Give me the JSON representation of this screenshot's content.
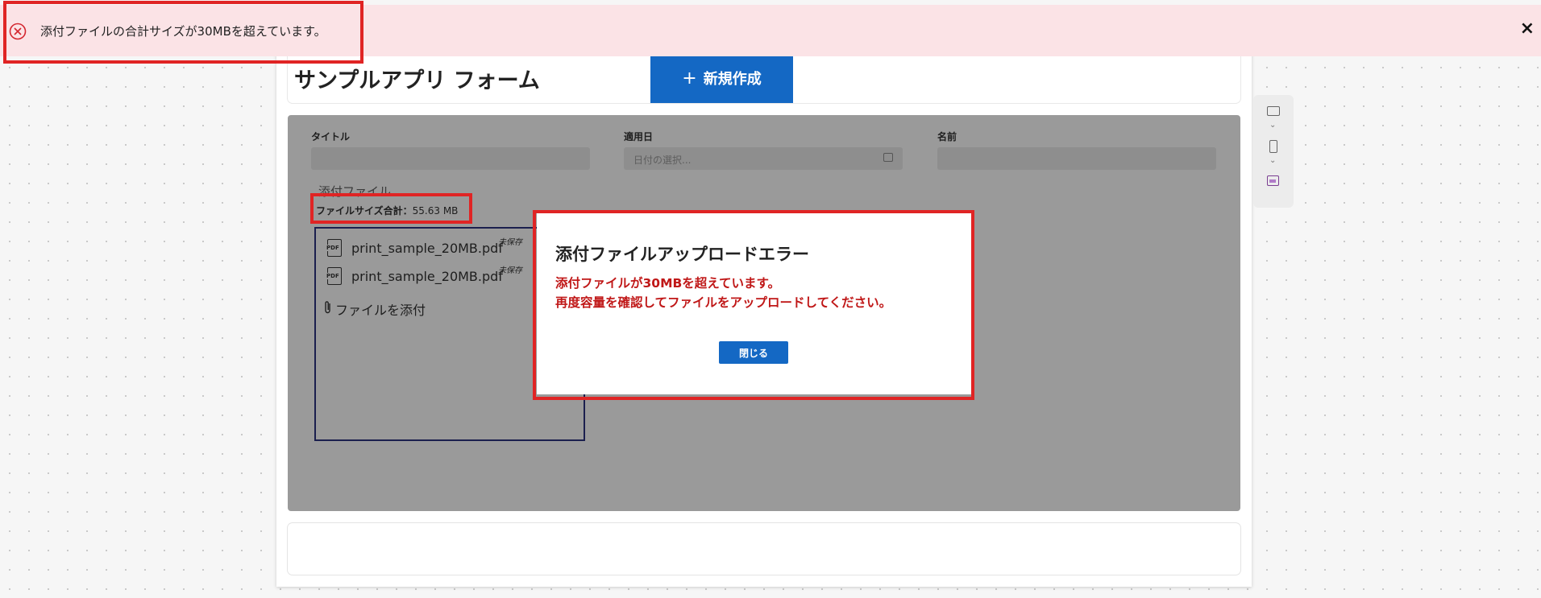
{
  "notification": {
    "message": "添付ファイルの合計サイズが30MBを超えています。",
    "close_symbol": "×",
    "icon": "error-circle-icon"
  },
  "header": {
    "app_title": "サンプルアプリ フォーム",
    "new_button_label": "新規作成",
    "new_button_plus": "+"
  },
  "form": {
    "title_label": "タイトル",
    "date_label": "適用日",
    "date_placeholder": "日付の選択...",
    "name_label": "名前",
    "attachment_label": "添付ファイル",
    "size_total_label": "ファイルサイズ合計：",
    "size_total_value": "55.63 MB",
    "files": [
      {
        "name": "print_sample_20MB.pdf",
        "status": "未保存",
        "icon_text": "PDF"
      },
      {
        "name": "print_sample_20MB.pdf",
        "status": "未保存",
        "icon_text": "PDF"
      }
    ],
    "attach_button_label": "ファイルを添付"
  },
  "dialog": {
    "title": "添付ファイルアップロードエラー",
    "message_line1": "添付ファイルが30MBを超えています。",
    "message_line2": "再度容量を確認してファイルをアップロードしてください。",
    "close_button_label": "閉じる"
  },
  "side_toolbar": {
    "icons": [
      "monitor-icon",
      "phone-icon",
      "app-icon"
    ],
    "chevron": "⌄"
  },
  "colors": {
    "notification_bg": "#fbe3e6",
    "accent_blue": "#1468c4",
    "error_red": "#c01818",
    "highlight_red": "#e02424",
    "overlay_gray": "#9a9a9a"
  }
}
